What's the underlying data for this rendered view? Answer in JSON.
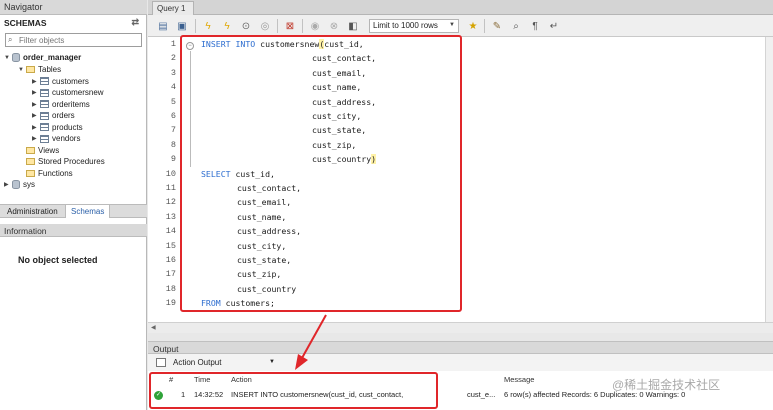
{
  "navigator": {
    "title": "Navigator",
    "schemas_label": "SCHEMAS",
    "filter_placeholder": "Filter objects",
    "database": "order_manager",
    "tables_label": "Tables",
    "tables": [
      "customers",
      "customersnew",
      "orderitems",
      "orders",
      "products",
      "vendors"
    ],
    "views_label": "Views",
    "procedures_label": "Stored Procedures",
    "functions_label": "Functions",
    "other_db": "sys",
    "tab_admin": "Administration",
    "tab_schemas": "Schemas",
    "info_title": "Information",
    "no_object": "No object selected"
  },
  "query": {
    "tab_label": "Query 1",
    "limit_label": "Limit to 1000 rows",
    "lines": [
      {
        "n": "1"
      },
      {
        "n": "2"
      },
      {
        "n": "3"
      },
      {
        "n": "4"
      },
      {
        "n": "5"
      },
      {
        "n": "6"
      },
      {
        "n": "7"
      },
      {
        "n": "8"
      },
      {
        "n": "9"
      },
      {
        "n": "10"
      },
      {
        "n": "11"
      },
      {
        "n": "12"
      },
      {
        "n": "13"
      },
      {
        "n": "14"
      },
      {
        "n": "15"
      },
      {
        "n": "16"
      },
      {
        "n": "17"
      },
      {
        "n": "18"
      },
      {
        "n": "19"
      }
    ],
    "code": {
      "l1_kw": "INSERT INTO",
      "l1_rest": " customersnew",
      "l1_paren": "(",
      "l1_tail": "cust_id,",
      "l2": "cust_contact,",
      "l3": "cust_email,",
      "l4": "cust_name,",
      "l5": "cust_address,",
      "l6": "cust_city,",
      "l7": "cust_state,",
      "l8": "cust_zip,",
      "l9": "cust_country",
      "l9_paren": ")",
      "l10_kw": "SELECT",
      "l10_rest": " cust_id,",
      "l11": "cust_contact,",
      "l12": "cust_email,",
      "l13": "cust_name,",
      "l14": "cust_address,",
      "l15": "cust_city,",
      "l16": "cust_state,",
      "l17": "cust_zip,",
      "l18": "cust_country",
      "l19_kw": "FROM",
      "l19_rest": " customers;"
    }
  },
  "output": {
    "title": "Output",
    "selector": "Action Output",
    "col_num": "#",
    "col_time": "Time",
    "col_action": "Action",
    "col_message": "Message",
    "row": {
      "num": "1",
      "time": "14:32:52",
      "action": "INSERT INTO customersnew(cust_id,    cust_contact,",
      "action_tail": "cust_e...",
      "message": "6 row(s) affected Records: 6  Duplicates: 0  Warnings: 0"
    }
  },
  "watermark": "@稀土掘金技术社区",
  "colors": {
    "keyword": "#2b6ccf",
    "highlight": "#e0262a",
    "ok": "#2fa339"
  }
}
